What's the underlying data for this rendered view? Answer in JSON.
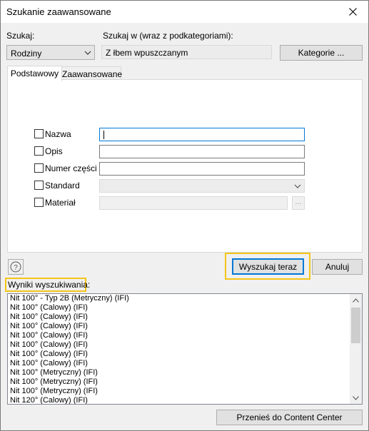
{
  "window": {
    "title": "Szukanie zaawansowane",
    "close_icon": "close-icon"
  },
  "search_in": {
    "label": "Szukaj:",
    "selected": "Rodziny"
  },
  "search_scope": {
    "label": "Szukaj w (wraz z podkategoriami):",
    "value": "Z łbem wpuszczanym"
  },
  "categories_button": "Kategorie ...",
  "tabs": [
    {
      "label": "Podstawowy",
      "active": true
    },
    {
      "label": "Zaawansowane",
      "active": false
    }
  ],
  "criteria": [
    {
      "label": "Nazwa",
      "checked": false,
      "value": "",
      "type": "text",
      "focused": true
    },
    {
      "label": "Opis",
      "checked": false,
      "value": "",
      "type": "text"
    },
    {
      "label": "Numer części",
      "checked": false,
      "value": "",
      "type": "text"
    },
    {
      "label": "Standard",
      "checked": false,
      "value": "",
      "type": "combo-disabled"
    },
    {
      "label": "Materiał",
      "checked": false,
      "value": "",
      "type": "text-disabled-browse",
      "browse_label": "..."
    }
  ],
  "help_icon": "help-icon",
  "search_now_button": "Wyszukaj teraz",
  "cancel_button": "Anuluj",
  "results": {
    "label": "Wyniki wyszukiwania:",
    "items": [
      "Nit 100° - Typ 2B (Metryczny) (IFI)",
      "Nit 100° (Calowy) (IFI)",
      "Nit 100° (Calowy) (IFI)",
      "Nit 100° (Calowy) (IFI)",
      "Nit 100° (Calowy) (IFI)",
      "Nit 100° (Calowy) (IFI)",
      "Nit 100° (Calowy) (IFI)",
      "Nit 100° (Calowy) (IFI)",
      "Nit 100° (Metryczny) (IFI)",
      "Nit 100° (Metryczny) (IFI)",
      "Nit 100° (Metryczny) (IFI)",
      "Nit 120° (Calowy) (IFI)"
    ]
  },
  "go_to_content_center_button": "Przenieś do Content Center",
  "colors": {
    "highlight": "#f5c518",
    "focus_border": "#0078d7",
    "dialog_bg": "#f0f0f0"
  }
}
